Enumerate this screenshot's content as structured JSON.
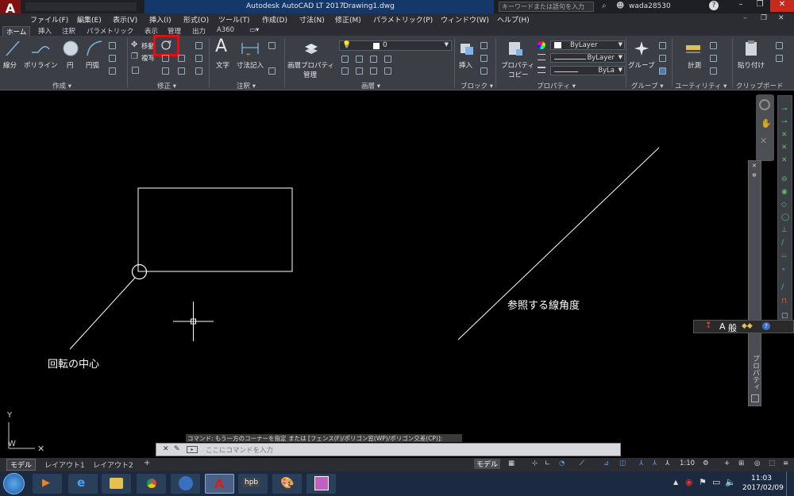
{
  "title_bar": {
    "app_title": "Autodesk AutoCAD LT 2017",
    "doc_title": "Drawing1.dwg",
    "search_placeholder": "キーワードまたは語句を入力",
    "username": "wada28530"
  },
  "menu": [
    "ファイル(F)",
    "編集(E)",
    "表示(V)",
    "挿入(I)",
    "形式(O)",
    "ツール(T)",
    "作成(D)",
    "寸法(N)",
    "修正(M)",
    "パラメトリック(P)",
    "ウィンドウ(W)",
    "ヘルプ(H)"
  ],
  "tabs": [
    "ホーム",
    "挿入",
    "注釈",
    "パラメトリック",
    "表示",
    "管理",
    "出力",
    "A360"
  ],
  "ribbon": {
    "draw": {
      "line": "線分",
      "polyline": "ポリライン",
      "circle": "円",
      "arc": "円弧",
      "panel": "作成 ▾"
    },
    "modify": {
      "move": "移動",
      "copy": "複写",
      "panel": "修正 ▾"
    },
    "annotation": {
      "text": "文字",
      "dimension": "寸法記入",
      "panel": "注釈 ▾"
    },
    "layers": {
      "properties_l1": "画層プロパティ",
      "properties_l2": "管理",
      "current_layer": "0",
      "panel": "画層 ▾"
    },
    "block": {
      "insert": "挿入",
      "panel": "ブロック ▾"
    },
    "properties": {
      "match_l1": "プロパティ",
      "match_l2": "コピー",
      "color": "ByLayer",
      "linetype": "ByLayer",
      "lineweight": "ByLa",
      "panel": "プロパティ ▾"
    },
    "groups": {
      "group": "グループ",
      "panel": "グループ ▾"
    },
    "utilities": {
      "measure": "計測",
      "panel": "ユーティリティ ▾"
    },
    "clipboard": {
      "paste": "貼り付け",
      "panel": "クリップボード"
    }
  },
  "drawing": {
    "label_center": "回転の中心",
    "label_reference": "参照する線角度",
    "ucs_y": "Y",
    "ucs_w": "W"
  },
  "command": {
    "history": "コマンド: もう一方のコーナーを指定 または [フェンス(F)/ポリゴン窓(WP)/ポリゴン交差(CP)]:",
    "placeholder": "ここにコマンドを入力"
  },
  "layout_tabs": [
    "モデル",
    "レイアウト1",
    "レイアウト2"
  ],
  "status": {
    "model": "モデル",
    "scale": "1:10"
  },
  "ime": {
    "mode": "A",
    "kana": "般"
  },
  "properties_palette": "プロパティ",
  "taskbar": {
    "time": "11:03",
    "date": "2017/02/09"
  }
}
